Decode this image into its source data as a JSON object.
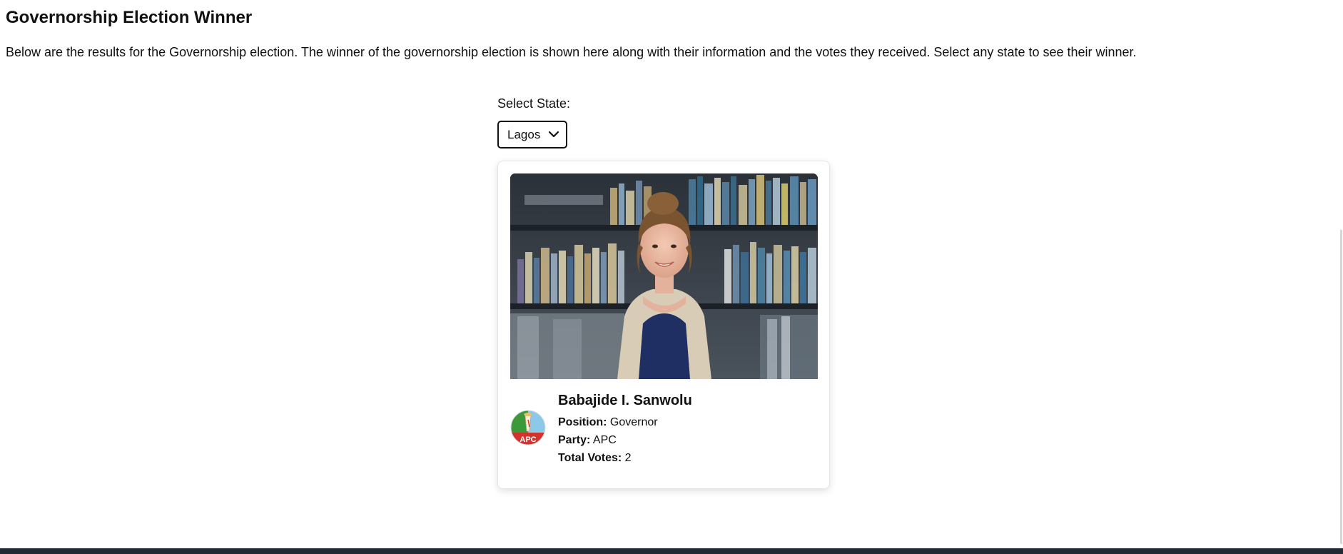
{
  "page": {
    "title": "Governorship Election Winner",
    "description": "Below are the results for the Governorship election. The winner of the governorship election is shown here along with their information and the votes they received. Select any state to see their winner."
  },
  "state_selector": {
    "label": "Select State:",
    "selected": "Lagos"
  },
  "winner": {
    "name": "Babajide I. Sanwolu",
    "position_label": "Position:",
    "position": "Governor",
    "party_label": "Party:",
    "party": "APC",
    "votes_label": "Total Votes:",
    "votes": "2",
    "party_logo_text": "APC"
  },
  "colors": {
    "text": "#111111",
    "card_border": "#e4e4e4",
    "footer": "#232a33",
    "apc_green": "#3a9a3a",
    "apc_blue": "#8cc8e8",
    "apc_red": "#d4322c"
  },
  "icons": {
    "select_arrow": "chevron-down-icon",
    "party_logo": "apc-logo-icon"
  }
}
